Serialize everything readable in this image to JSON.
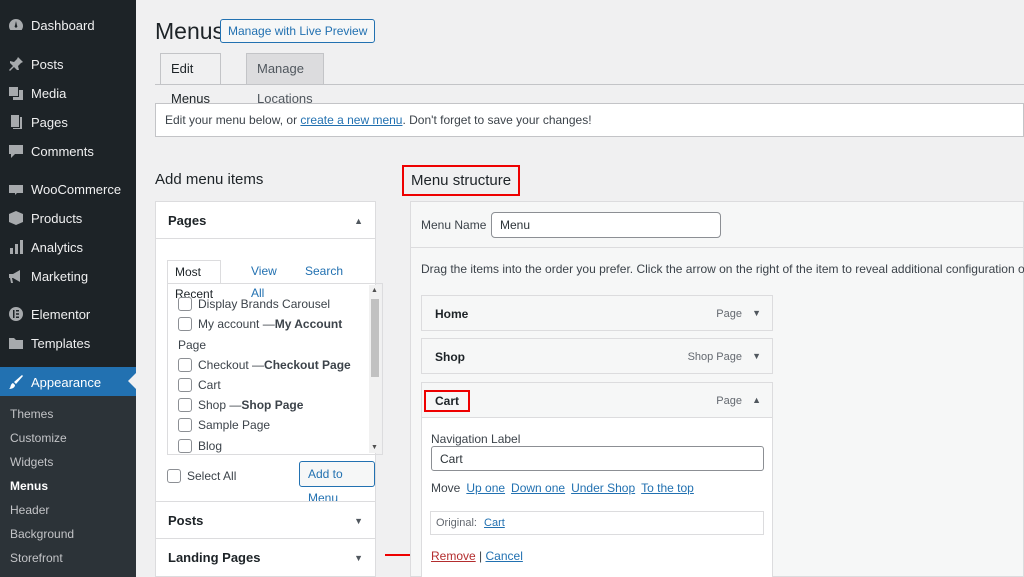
{
  "sidebar": {
    "items": [
      {
        "label": "Dashboard",
        "icon": "dashboard-icon"
      },
      {
        "label": "Posts",
        "icon": "pin-icon"
      },
      {
        "label": "Media",
        "icon": "media-icon"
      },
      {
        "label": "Pages",
        "icon": "pages-icon"
      },
      {
        "label": "Comments",
        "icon": "comment-icon"
      },
      {
        "label": "WooCommerce",
        "icon": "woo-icon"
      },
      {
        "label": "Products",
        "icon": "box-icon"
      },
      {
        "label": "Analytics",
        "icon": "chart-icon"
      },
      {
        "label": "Marketing",
        "icon": "megaphone-icon"
      },
      {
        "label": "Elementor",
        "icon": "elementor-icon"
      },
      {
        "label": "Templates",
        "icon": "folder-icon"
      },
      {
        "label": "Appearance",
        "icon": "brush-icon"
      }
    ],
    "submenu": [
      "Themes",
      "Customize",
      "Widgets",
      "Menus",
      "Header",
      "Background",
      "Storefront"
    ]
  },
  "header": {
    "title": "Menus",
    "live_preview_label": "Manage with Live Preview",
    "tabs": [
      "Edit Menus",
      "Manage Locations"
    ]
  },
  "notice": {
    "before": "Edit your menu below, or ",
    "link": "create a new menu",
    "after": ". Don't forget to save your changes!"
  },
  "add_items": {
    "heading": "Add menu items",
    "pages_panel": {
      "title": "Pages",
      "tabs": [
        "Most Recent",
        "View All",
        "Search"
      ],
      "rows": [
        {
          "label": "Display Brands Carousel",
          "bold": ""
        },
        {
          "label": "My account — ",
          "bold": "My Account"
        },
        {
          "label": "Checkout — ",
          "bold": "Checkout Page"
        },
        {
          "label": "Cart",
          "bold": ""
        },
        {
          "label": "Shop — ",
          "bold": "Shop Page"
        },
        {
          "label": "Sample Page",
          "bold": ""
        },
        {
          "label": "Blog",
          "bold": ""
        }
      ],
      "continuation": "Page",
      "select_all": "Select All",
      "add_button": "Add to Menu"
    },
    "posts_title": "Posts",
    "landing_title": "Landing Pages"
  },
  "structure": {
    "heading": "Menu structure",
    "menu_name_label": "Menu Name",
    "menu_name_value": "Menu",
    "instructions": "Drag the items into the order you prefer. Click the arrow on the right of the item to reveal additional configuration options.",
    "items": [
      {
        "name": "Home",
        "type": "Page",
        "arrow": "▼"
      },
      {
        "name": "Shop",
        "type": "Shop Page",
        "arrow": "▼"
      },
      {
        "name": "Cart",
        "type": "Page",
        "arrow": "▲"
      }
    ],
    "settings": {
      "nav_label_caption": "Navigation Label",
      "nav_label_value": "Cart",
      "move_label": "Move",
      "move_links": [
        "Up one",
        "Down one",
        "Under Shop",
        "To the top"
      ],
      "original_label": "Original:",
      "original_link": "Cart",
      "remove": "Remove",
      "separator": "|",
      "cancel": "Cancel"
    }
  },
  "colors": {
    "sidebar_bg": "#1d2327",
    "accent": "#2271b1",
    "highlight": "#e00000"
  }
}
